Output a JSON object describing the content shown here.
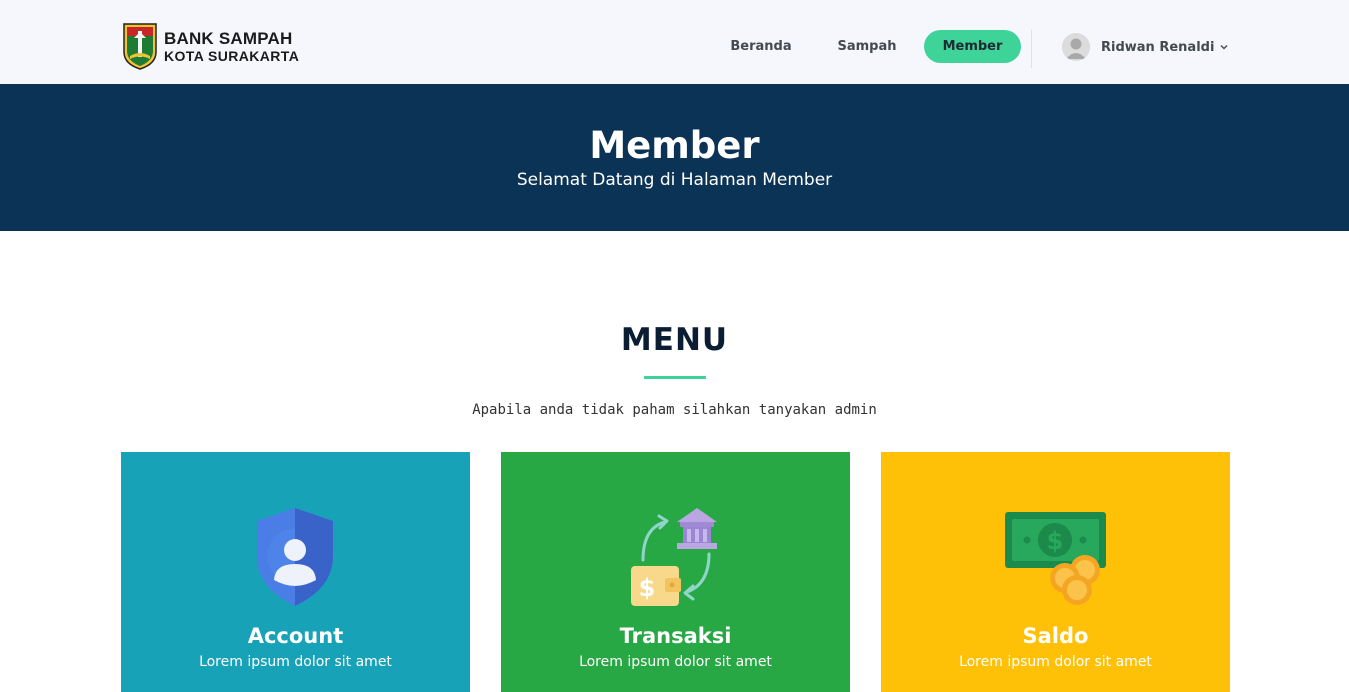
{
  "brand": {
    "line1": "BANK SAMPAH",
    "line2": "KOTA SURAKARTA"
  },
  "nav": {
    "items": [
      {
        "label": "Beranda"
      },
      {
        "label": "Sampah"
      },
      {
        "label": "Member",
        "active": true
      }
    ],
    "user_name": "Ridwan Renaldi"
  },
  "hero": {
    "title": "Member",
    "subtitle": "Selamat Datang di Halaman Member"
  },
  "menu": {
    "title": "MENU",
    "description": "Apabila anda tidak paham silahkan tanyakan admin",
    "cards": [
      {
        "title": "Account",
        "text": "Lorem ipsum dolor sit amet",
        "icon": "account-shield-icon",
        "color": "#18a2b8"
      },
      {
        "title": "Transaksi",
        "text": "Lorem ipsum dolor sit amet",
        "icon": "transaction-icon",
        "color": "#28a745"
      },
      {
        "title": "Saldo",
        "text": "Lorem ipsum dolor sit amet",
        "icon": "money-coins-icon",
        "color": "#ffc107"
      }
    ]
  },
  "colors": {
    "header_bg": "#f6f7fd",
    "hero_bg": "#0b3356",
    "accent": "#3ed399"
  }
}
